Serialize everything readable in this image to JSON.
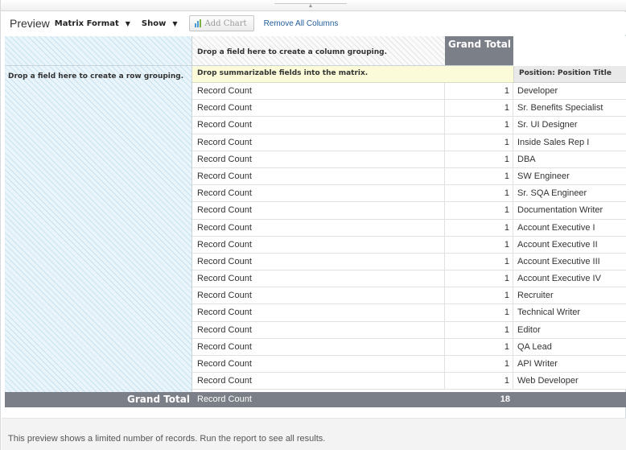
{
  "toolbar": {
    "preview_label": "Preview",
    "matrix_format_label": "Matrix Format",
    "show_label": "Show",
    "add_chart_label": "Add Chart",
    "remove_all_columns_label": "Remove All Columns"
  },
  "matrix": {
    "column_drop_text": "Drop a field here to create a column grouping.",
    "row_drop_text": "Drop a field here to create a row grouping.",
    "summarizable_drop_text": "Drop summarizable fields into the matrix.",
    "grand_total_header": "Grand Total",
    "position_header": "Position: Position Title",
    "rows": [
      {
        "label": "Record Count",
        "count": "1",
        "position": "Developer"
      },
      {
        "label": "Record Count",
        "count": "1",
        "position": "Sr. Benefits Specialist"
      },
      {
        "label": "Record Count",
        "count": "1",
        "position": "Sr. UI Designer"
      },
      {
        "label": "Record Count",
        "count": "1",
        "position": "Inside Sales Rep I"
      },
      {
        "label": "Record Count",
        "count": "1",
        "position": "DBA"
      },
      {
        "label": "Record Count",
        "count": "1",
        "position": "SW Engineer"
      },
      {
        "label": "Record Count",
        "count": "1",
        "position": "Sr. SQA Engineer"
      },
      {
        "label": "Record Count",
        "count": "1",
        "position": "Documentation Writer"
      },
      {
        "label": "Record Count",
        "count": "1",
        "position": "Account Executive I"
      },
      {
        "label": "Record Count",
        "count": "1",
        "position": "Account Executive II"
      },
      {
        "label": "Record Count",
        "count": "1",
        "position": "Account Executive III"
      },
      {
        "label": "Record Count",
        "count": "1",
        "position": "Account Executive IV"
      },
      {
        "label": "Record Count",
        "count": "1",
        "position": "Recruiter"
      },
      {
        "label": "Record Count",
        "count": "1",
        "position": "Technical Writer"
      },
      {
        "label": "Record Count",
        "count": "1",
        "position": "Editor"
      },
      {
        "label": "Record Count",
        "count": "1",
        "position": "QA Lead"
      },
      {
        "label": "Record Count",
        "count": "1",
        "position": "API Writer"
      },
      {
        "label": "Record Count",
        "count": "1",
        "position": "Web Developer"
      }
    ],
    "grand_total_row": {
      "label": "Grand Total",
      "measure": "Record Count",
      "value": "18"
    }
  },
  "footer": {
    "note": "This preview shows a limited number of records. Run the report to see all results."
  },
  "icons": {
    "menu_caret": "chevron-down-icon",
    "chart": "bar-chart-icon"
  },
  "colors": {
    "grand_total_bg": "#7b7f88",
    "drop_zone_bg": "#eaf5fb",
    "summarizable_bg": "#fbfbd9",
    "link": "#215d9b"
  }
}
